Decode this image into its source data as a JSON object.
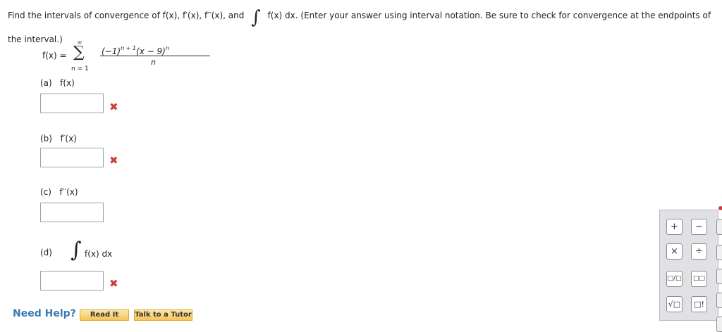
{
  "prompt": {
    "before": "Find the intervals of convergence of f(x), f′(x), f′′(x), and",
    "after": "f(x) dx. (Enter your answer using interval notation. Be sure to check for convergence at the endpoints of the interval.)"
  },
  "series": {
    "lhs": "f(x) =",
    "sigma": "∑",
    "upper": "∞",
    "lower": "n = 1",
    "numerator_base": "(−1)",
    "numerator_exp": "n + 1",
    "numerator_rest": "(x − 9)",
    "numerator_rest_exp": "n",
    "denominator": "n"
  },
  "parts": {
    "a": {
      "letter": "(a)",
      "label": "f(x)"
    },
    "b": {
      "letter": "(b)",
      "label": "f′(x)"
    },
    "c": {
      "letter": "(c)",
      "label": "f′′(x)"
    },
    "d": {
      "letter": "(d)",
      "label": "f(x) dx"
    }
  },
  "incorrect_mark": "✖",
  "help": {
    "label": "Need Help?",
    "read_it": "Read It",
    "talk_to_tutor": "Talk to a Tutor"
  },
  "palette": {
    "plus": "+",
    "minus": "−",
    "times": "×",
    "divide": "÷",
    "fraction": "□/□",
    "power": "□□",
    "sqrt": "√□",
    "factorial": "□!"
  },
  "colors": {
    "error": "#d23b3b",
    "link": "#3a7ab3",
    "button": "#f4c558"
  }
}
